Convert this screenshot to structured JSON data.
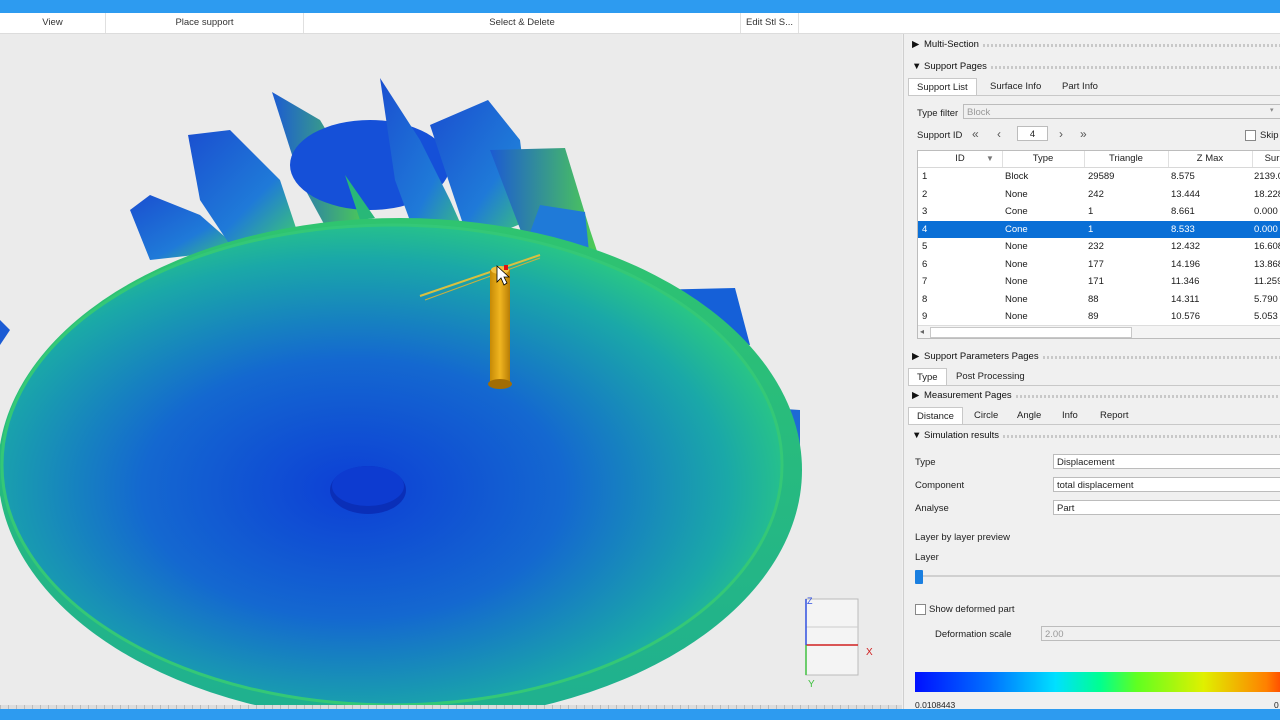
{
  "ribbon": {
    "groups": [
      "View",
      "Place support",
      "Select & Delete",
      "Edit Stl S..."
    ]
  },
  "viewport": {
    "axes": {
      "z": "Z",
      "x": "X",
      "y": "Y"
    }
  },
  "panel": {
    "multi_section": "Multi-Section",
    "support_pages": "Support Pages",
    "support_tabs": [
      "Support List",
      "Surface Info",
      "Part Info"
    ],
    "type_filter_label": "Type filter",
    "type_filter_value": "Block",
    "support_id_label": "Support ID",
    "support_id_value": "4",
    "skip_label": "Skip",
    "table": {
      "columns": [
        "ID",
        "Type",
        "Triangle",
        "Z Max",
        "Sur"
      ],
      "rows": [
        [
          "1",
          "Block",
          "29589",
          "8.575",
          "2139.0"
        ],
        [
          "2",
          "None",
          "242",
          "13.444",
          "18.228"
        ],
        [
          "3",
          "Cone",
          "1",
          "8.661",
          "0.000"
        ],
        [
          "4",
          "Cone",
          "1",
          "8.533",
          "0.000"
        ],
        [
          "5",
          "None",
          "232",
          "12.432",
          "16.608"
        ],
        [
          "6",
          "None",
          "177",
          "14.196",
          "13.868"
        ],
        [
          "7",
          "None",
          "171",
          "11.346",
          "11.259"
        ],
        [
          "8",
          "None",
          "88",
          "14.311",
          "5.790"
        ],
        [
          "9",
          "None",
          "89",
          "10.576",
          "5.053"
        ]
      ],
      "selected_row": 3
    },
    "support_params": "Support Parameters Pages",
    "params_tabs": [
      "Type",
      "Post Processing"
    ],
    "measurement": "Measurement Pages",
    "measure_tabs": [
      "Distance",
      "Circle",
      "Angle",
      "Info",
      "Report"
    ],
    "simulation": "Simulation results",
    "type_label": "Type",
    "type_value": "Displacement",
    "component_label": "Component",
    "component_value": "total displacement",
    "analyse_label": "Analyse",
    "analyse_value": "Part",
    "layer_preview": "Layer by layer preview",
    "layer_label": "Layer",
    "show_deformed": "Show deformed part",
    "deform_scale_label": "Deformation scale",
    "deform_scale_value": "2.00",
    "legend_min": "0.0108443",
    "legend_max_cut": "0"
  },
  "colors": {
    "accent": "#2d9bf0",
    "selected": "#0a6fd6"
  }
}
